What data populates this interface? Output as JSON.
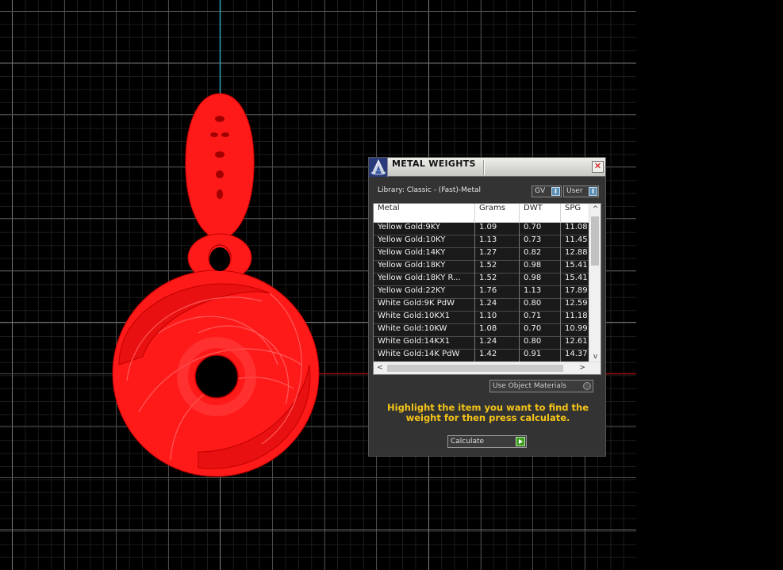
{
  "dialog": {
    "title": "METAL WEIGHTS",
    "close_label": "✕",
    "app_icon": "app-logo-icon",
    "library_label": "Library: Classic - (Fast)-Metal",
    "gv_select": "GV",
    "user_select": "User",
    "dropdown_arrow": "I",
    "table": {
      "headers": [
        "Metal",
        "Grams",
        "DWT",
        "SPG"
      ],
      "rows": [
        [
          "Yellow Gold:9KY",
          "1.09",
          "0.70",
          "11.08"
        ],
        [
          "Yellow Gold:10KY",
          "1.13",
          "0.73",
          "11.45"
        ],
        [
          "Yellow Gold:14KY",
          "1.27",
          "0.82",
          "12.88"
        ],
        [
          "Yellow Gold:18KY",
          "1.52",
          "0.98",
          "15.41"
        ],
        [
          "Yellow Gold:18KY R...",
          "1.52",
          "0.98",
          "15.41"
        ],
        [
          "Yellow Gold:22KY",
          "1.76",
          "1.13",
          "17.89"
        ],
        [
          "White Gold:9K PdW",
          "1.24",
          "0.80",
          "12.59"
        ],
        [
          "White Gold:10KX1",
          "1.10",
          "0.71",
          "11.18"
        ],
        [
          "White Gold:10KW",
          "1.08",
          "0.70",
          "10.99"
        ],
        [
          "White Gold:14KX1",
          "1.24",
          "0.80",
          "12.61"
        ],
        [
          "White Gold:14K PdW",
          "1.42",
          "0.91",
          "14.37"
        ]
      ]
    },
    "scroll_up": "^",
    "scroll_down": "v",
    "scroll_left": "<",
    "scroll_right": ">",
    "use_object_materials": "Use Object Materials",
    "instructions": "Highlight the item you want to find the weight for then press calculate.",
    "calculate_label": "Calculate"
  },
  "colors": {
    "instruction_text": "#f5c518",
    "model": "#ff1a1a",
    "grid": "#505050",
    "axis_y": "#2aa3b8",
    "axis_x": "#a01010"
  }
}
